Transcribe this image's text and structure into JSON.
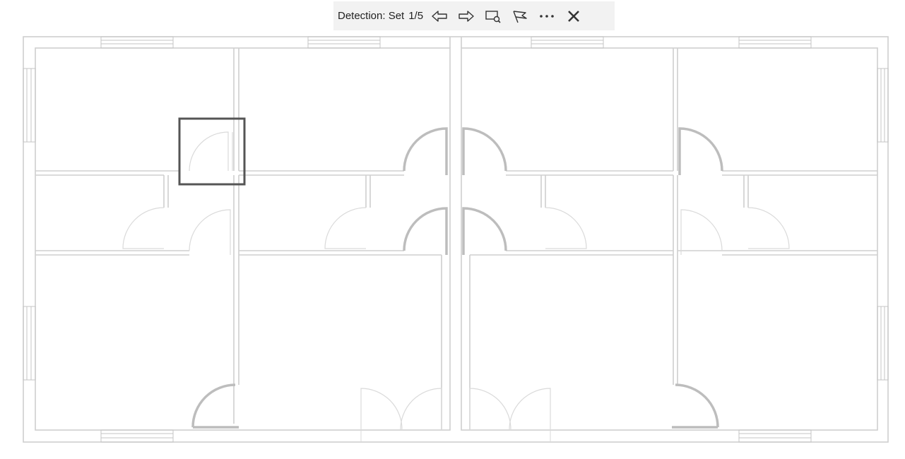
{
  "toolbar": {
    "label": "Detection: Set",
    "counter": "1/5",
    "buttons": [
      {
        "name": "previous-button",
        "icon": "arrow-left-icon"
      },
      {
        "name": "next-button",
        "icon": "arrow-right-icon"
      },
      {
        "name": "zoom-to-detection-button",
        "icon": "zoom-rect-icon"
      },
      {
        "name": "flag-button",
        "icon": "flag-icon"
      },
      {
        "name": "more-button",
        "icon": "ellipsis-icon"
      },
      {
        "name": "close-button",
        "icon": "close-icon"
      }
    ]
  },
  "canvas": {
    "selection_color": "#555555",
    "wall_color": "#cfcfcf"
  }
}
